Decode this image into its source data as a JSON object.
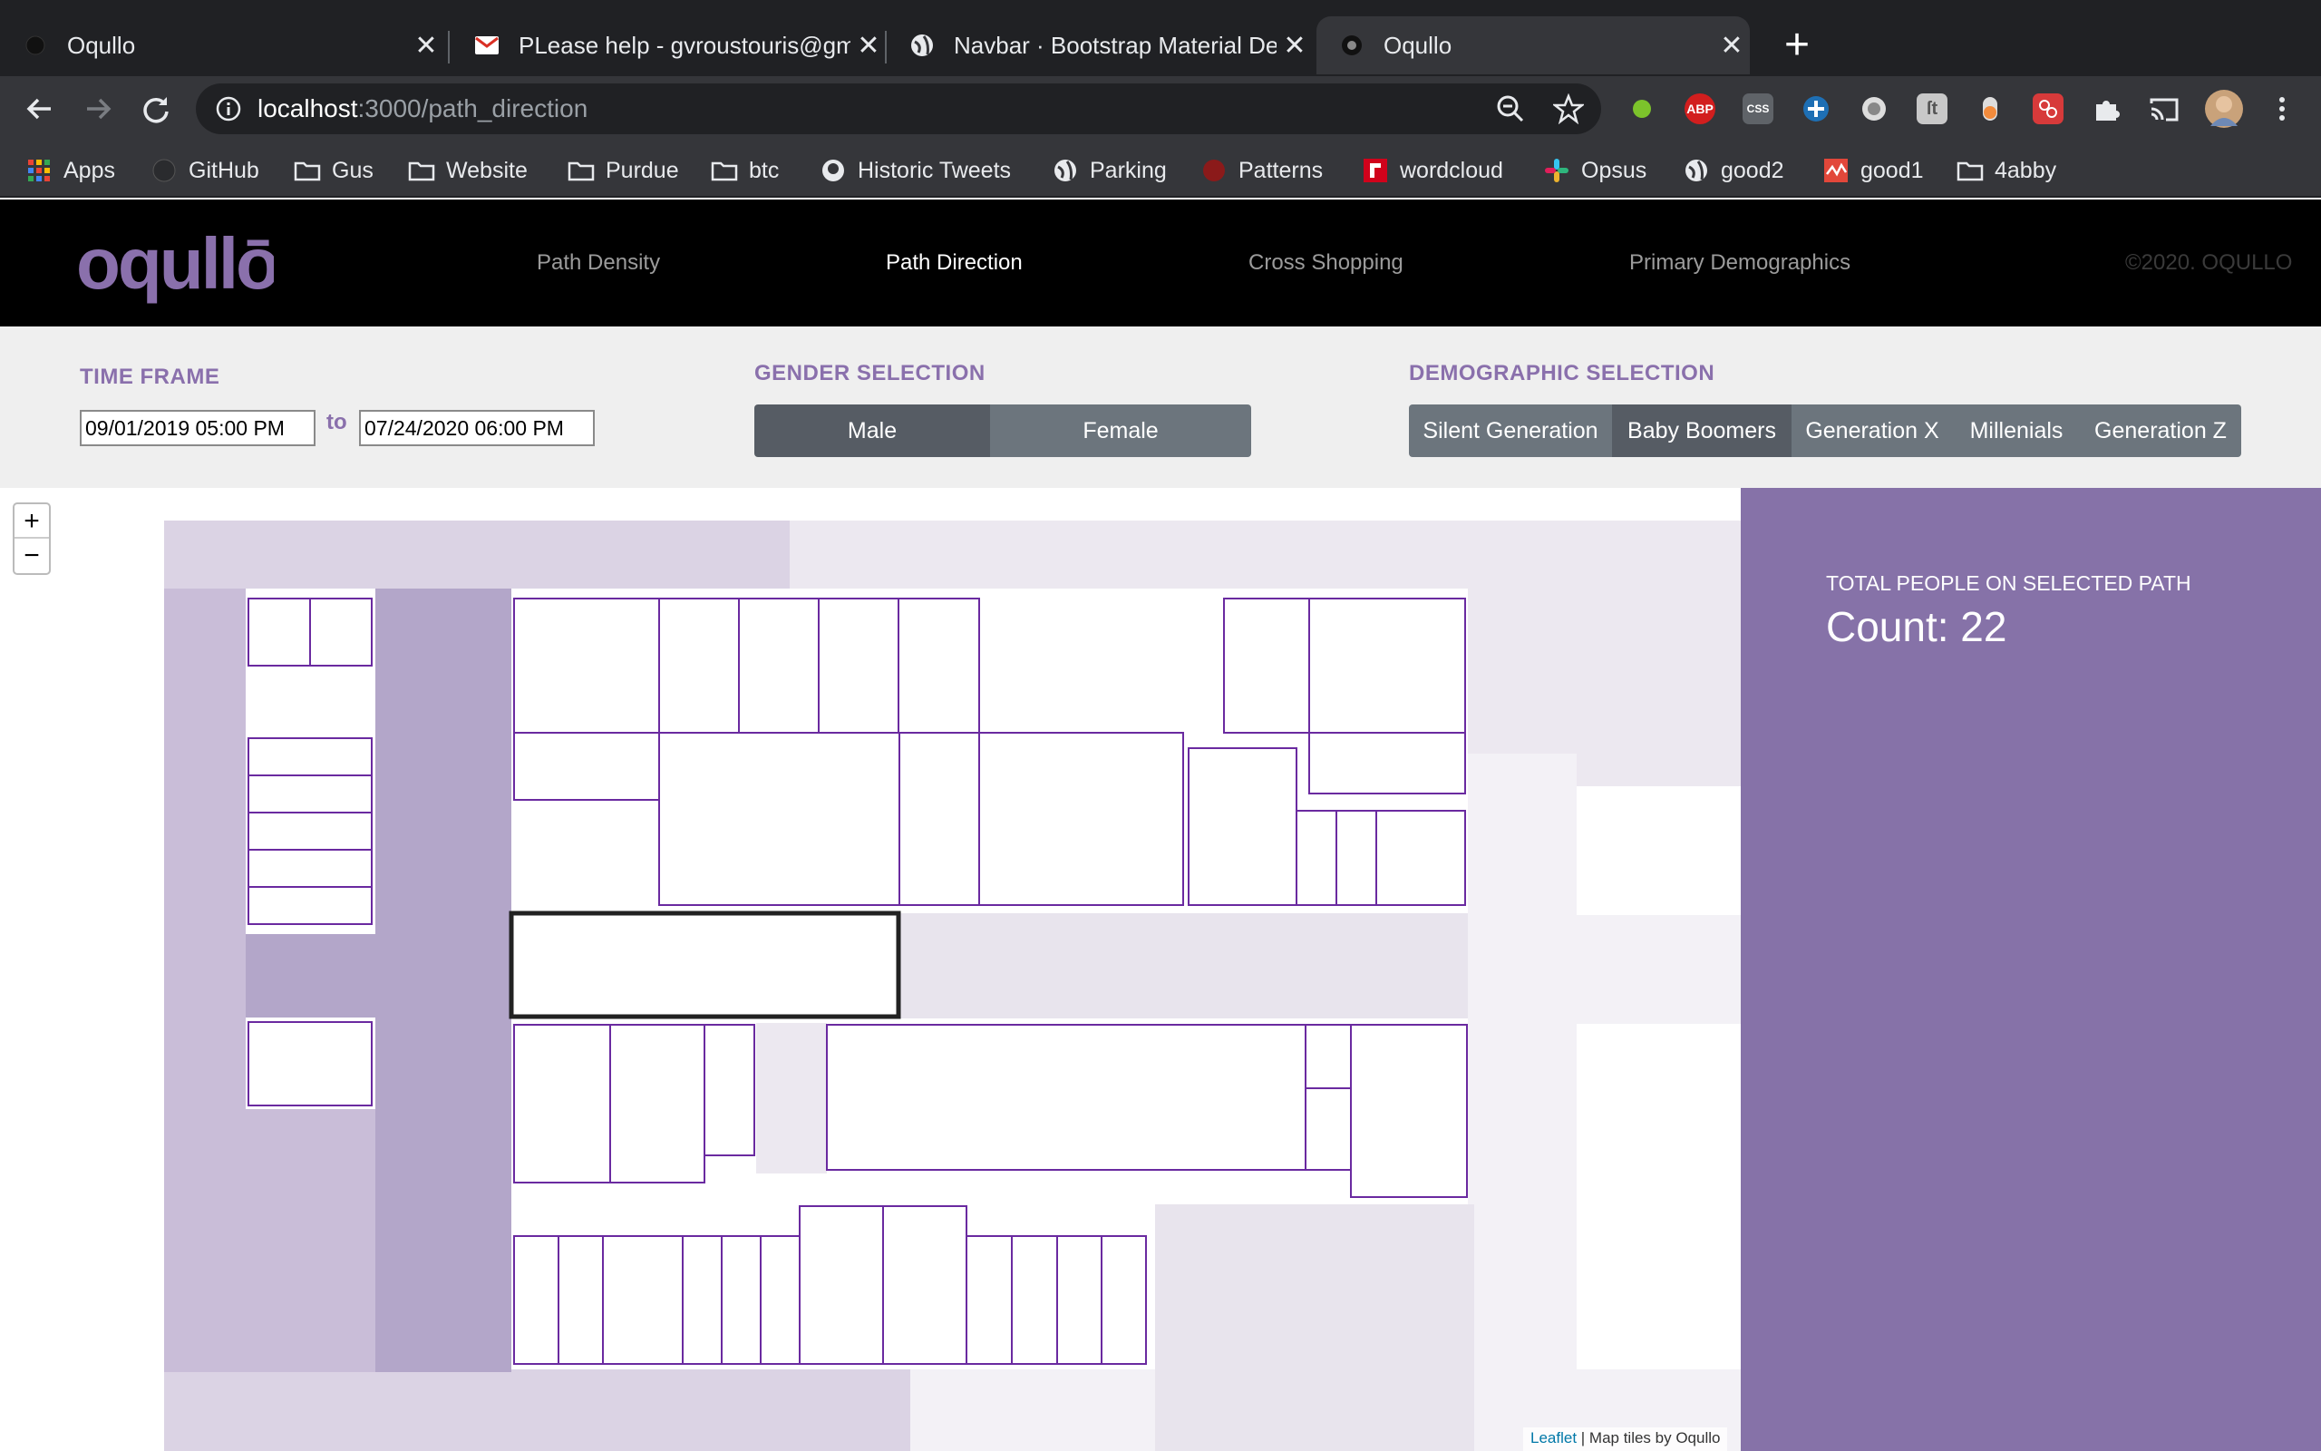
{
  "browser": {
    "tabs": [
      {
        "title": "Oqullo",
        "icon": "oqullo-favicon-icon",
        "active": false
      },
      {
        "title": "PLease help - gvroustouris@gm",
        "icon": "gmail-icon",
        "active": false
      },
      {
        "title": "Navbar · Bootstrap Material De",
        "icon": "globe-icon",
        "active": false
      },
      {
        "title": "Oqullo",
        "icon": "oqullo-favicon-icon",
        "active": true
      }
    ],
    "new_tab": "+",
    "address": {
      "host": "localhost",
      "path": ":3000/path_direction"
    },
    "extensions": [
      "green-dot-icon",
      "adblock-plus-icon",
      "css-icon",
      "dropbox-icon",
      "circle-icon",
      "font-icon",
      "orange-toggle-icon",
      "red-app-icon",
      "puzzle-icon",
      "cast-icon",
      "profile-avatar-icon",
      "more-menu-icon"
    ],
    "bookmarks": [
      {
        "label": "Apps",
        "icon": "apps-grid-icon"
      },
      {
        "label": "GitHub",
        "icon": "github-icon"
      },
      {
        "label": "Gus",
        "icon": "folder-icon"
      },
      {
        "label": "Website",
        "icon": "folder-icon"
      },
      {
        "label": "Purdue",
        "icon": "folder-icon"
      },
      {
        "label": "btc",
        "icon": "folder-icon"
      },
      {
        "label": "Historic Tweets",
        "icon": "github-icon"
      },
      {
        "label": "Parking",
        "icon": "globe-icon"
      },
      {
        "label": "Patterns",
        "icon": "red-circle-icon"
      },
      {
        "label": "wordcloud",
        "icon": "red-square-icon"
      },
      {
        "label": "Opsus",
        "icon": "slack-icon"
      },
      {
        "label": "good2",
        "icon": "globe-icon"
      },
      {
        "label": "good1",
        "icon": "red-wave-icon"
      },
      {
        "label": "4abby",
        "icon": "folder-icon"
      }
    ]
  },
  "app": {
    "logo": "oqullō",
    "nav": [
      "Path Density",
      "Path Direction",
      "Cross Shopping",
      "Primary Demographics"
    ],
    "active_nav": "Path Direction",
    "copyright": "©2020. OQULLO"
  },
  "filters": {
    "time_frame": {
      "label": "TIME FRAME",
      "start": "09/01/2019 05:00 PM",
      "to": "to",
      "end": "07/24/2020 06:00 PM"
    },
    "gender": {
      "label": "GENDER SELECTION",
      "options": [
        "Male",
        "Female"
      ],
      "selected": "Male"
    },
    "demographic": {
      "label": "DEMOGRAPHIC SELECTION",
      "options": [
        "Silent Generation",
        "Baby Boomers",
        "Generation X",
        "Millenials",
        "Generation Z"
      ],
      "selected": "Baby Boomers"
    }
  },
  "map": {
    "zoom_in": "+",
    "zoom_out": "−",
    "attribution_link": "Leaflet",
    "attribution_text": " | Map tiles by Oqullo"
  },
  "panel": {
    "label": "TOTAL PEOPLE ON SELECTED PATH",
    "count": "Count: 22"
  },
  "colors": {
    "accent": "#8a70ac",
    "panel": "#8672a8",
    "store_outline": "#6a2aa0",
    "selected_outline": "#222222"
  }
}
